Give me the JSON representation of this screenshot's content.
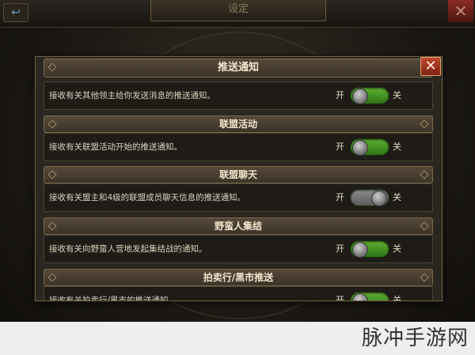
{
  "background": {
    "screen_title": "设定",
    "back_icon": "back-arrow-icon",
    "close_symbol": "✕"
  },
  "dialog": {
    "title": "推送通知",
    "close_symbol": "✕",
    "on_label": "开",
    "off_label": "关",
    "sections": [
      {
        "header": "",
        "text": "接收有关其他领主给你发送消息的推送通知。",
        "enabled": true
      },
      {
        "header": "联盟活动",
        "text": "接收有关联盟活动开始的推送通知。",
        "enabled": true
      },
      {
        "header": "联盟聊天",
        "text": "接收有关盟主和4级的联盟成员聊天信息的推送通知。",
        "enabled": false
      },
      {
        "header": "野蛮人集结",
        "text": "接收有关向野蛮人营地发起集结战的通知。",
        "enabled": true
      },
      {
        "header": "拍卖行/黑市推送",
        "text": "接收有关拍卖行/黑市的推送通知。",
        "enabled": true
      }
    ]
  },
  "watermark": {
    "text": "脉冲手游网"
  },
  "colors": {
    "toggle_on": "#4a9a25",
    "toggle_off": "#7a7a7a",
    "close_red": "#b33a22"
  }
}
